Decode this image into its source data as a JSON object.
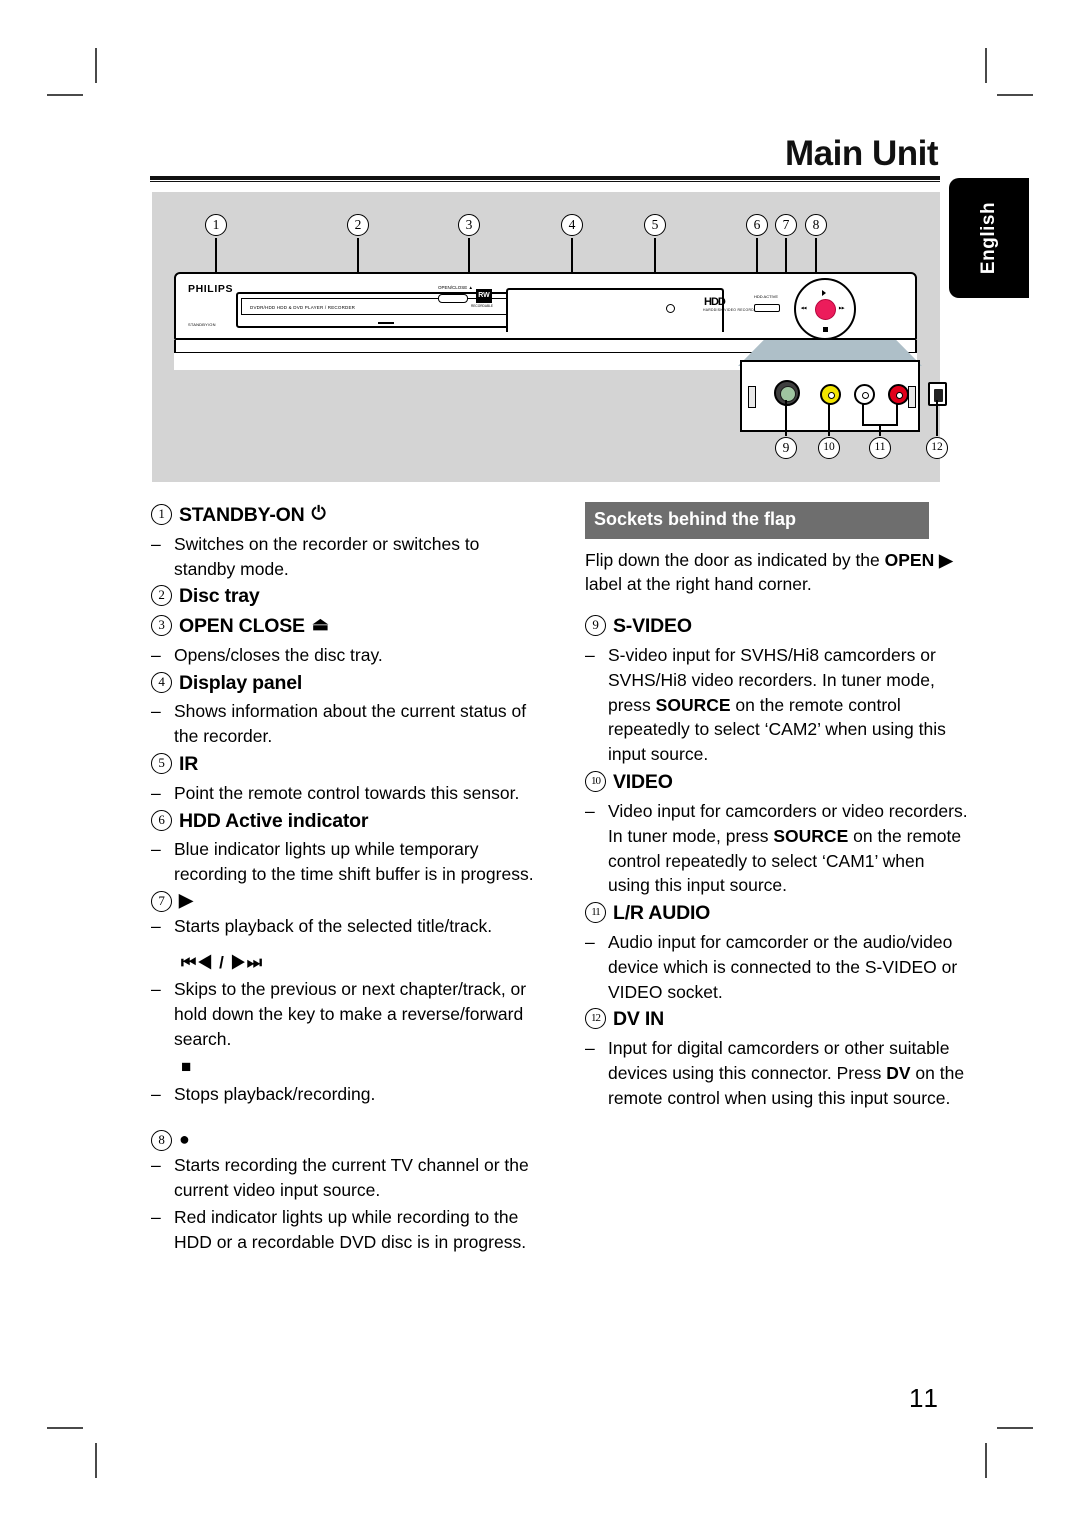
{
  "header": {
    "title": "Main Unit"
  },
  "lang_tab": {
    "label": "English"
  },
  "page_number": "11",
  "device": {
    "brand": "PHILIPS",
    "standby_label": "STANDBY/ON",
    "tray_label": "DVDR/HDD   HDD & DVD PLAYER / RECORDER",
    "open_close_label": "OPEN/CLOSE ▲",
    "rw_logo": "RW",
    "rw_caption": "RECORDABLE",
    "hdd_logo": "HDD",
    "hdd_caption": "HARDDISK VIDEO RECORDER",
    "hdd_active_label": "HDD ACTIVE",
    "open_flap_label": "OPEN ▶",
    "ring_labels": {
      "prev": "◀◀",
      "next": "▶▶",
      "play": "▶",
      "stop": "■"
    },
    "top_callouts": [
      "1",
      "2",
      "3",
      "4",
      "5",
      "6",
      "7",
      "8"
    ],
    "bottom_callouts": [
      "9",
      "10",
      "11",
      "12"
    ],
    "socket_names": [
      "s-video-socket",
      "video-socket-yellow",
      "audio-socket-white",
      "audio-socket-red",
      "dv-in-socket"
    ]
  },
  "left_column": [
    {
      "num": "1",
      "title": "STANDBY-ON",
      "glyph": "⏻",
      "bullets": [
        "Switches on the recorder or switches to standby mode."
      ]
    },
    {
      "num": "2",
      "title": "Disc tray",
      "glyph": "",
      "bullets": []
    },
    {
      "num": "3",
      "title": "OPEN CLOSE",
      "glyph": "⏏",
      "bullets": [
        "Opens/closes the disc tray."
      ]
    },
    {
      "num": "4",
      "title": "Display panel",
      "glyph": "",
      "bullets": [
        "Shows information about the current status of the recorder."
      ]
    },
    {
      "num": "5",
      "title": "IR",
      "glyph": "",
      "bullets": [
        "Point the remote control towards this sensor."
      ]
    },
    {
      "num": "6",
      "title": "HDD Active indicator",
      "glyph": "",
      "bullets": [
        "Blue indicator lights up while temporary recording to the time shift buffer is in progress."
      ]
    },
    {
      "num": "7",
      "title": "",
      "glyph": "▶",
      "bullets": [
        "Starts playback of the selected title/track."
      ],
      "sub": [
        {
          "glyph": "⏮◀ / ▶⏭",
          "bullets": [
            "Skips to the previous or next chapter/track, or hold down the key to make a reverse/forward search."
          ]
        },
        {
          "glyph": "■",
          "bullets": [
            "Stops playback/recording."
          ]
        }
      ]
    },
    {
      "num": "8",
      "title": "",
      "glyph": "●",
      "bullets": [
        "Starts recording the current TV channel or the current video input source.",
        "Red indicator lights up while recording to the HDD or a recordable DVD disc is in progress."
      ]
    }
  ],
  "right_column": {
    "flap_header": "Sockets behind the flap",
    "flap_intro_pre": "Flip down the door as indicated by the ",
    "flap_intro_bold": "OPEN ▶",
    "flap_intro_post": " label at the right hand corner.",
    "sections": [
      {
        "num": "9",
        "title": "S-VIDEO",
        "bullets": [
          "S-video input for SVHS/Hi8 camcorders or SVHS/Hi8 video recorders."
        ],
        "rich": {
          "pre": "In tuner mode, press ",
          "bold": "SOURCE",
          "post": " on the remote control repeatedly to select ‘CAM2’ when using this input source."
        }
      },
      {
        "num": "10",
        "title": "VIDEO",
        "bullets": [
          "Video input for camcorders or video recorders."
        ],
        "rich": {
          "pre": "In tuner mode, press ",
          "bold": "SOURCE",
          "post": " on the remote control repeatedly to select ‘CAM1’ when using this input source."
        }
      },
      {
        "num": "11",
        "title": "L/R AUDIO",
        "bullets": [
          "Audio input for camcorder or the audio/video device which is connected to the S-VIDEO or VIDEO socket."
        ],
        "rich": null
      },
      {
        "num": "12",
        "title": "DV IN",
        "bullets": [
          "Input for digital camcorders or other suitable devices using this connector."
        ],
        "rich": {
          "pre": "Press ",
          "bold": "DV",
          "post": " on the remote control when using this input source."
        }
      }
    ]
  }
}
